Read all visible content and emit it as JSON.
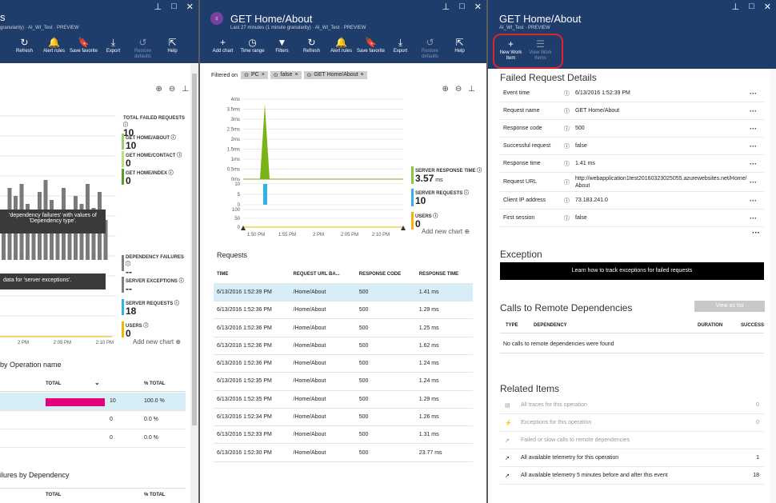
{
  "blade1": {
    "title": "s",
    "subtitle": "granularity) · AI_WI_Test · PREVIEW",
    "toolbar": [
      {
        "label": "Refresh",
        "icon": "↻"
      },
      {
        "label": "Alert rules",
        "icon": "🔔"
      },
      {
        "label": "Save favorite",
        "icon": "🔖"
      },
      {
        "label": "Export",
        "icon": "⤓"
      },
      {
        "label": "Restore defaults",
        "icon": "↺"
      },
      {
        "label": "Help",
        "icon": "⇱"
      }
    ],
    "metrics": [
      {
        "label": "TOTAL FAILED REQUESTS",
        "value": "10",
        "color": ""
      },
      {
        "label": "GET HOME/ABOUT",
        "value": "10",
        "color": "#9bd16a"
      },
      {
        "label": "GET HOME/CONTACT",
        "value": "0",
        "color": "#b8e07d"
      },
      {
        "label": "GET HOME/INDEX",
        "value": "0",
        "color": "#5b9b2a"
      },
      {
        "label": "DEPENDENCY FAILURES",
        "value": "--",
        "color": "#7f7f7f"
      },
      {
        "label": "SERVER EXCEPTIONS",
        "value": "--",
        "color": "#7f7f7f"
      },
      {
        "label": "SERVER REQUESTS",
        "value": "18",
        "color": "#2fb3e8"
      },
      {
        "label": "USERS",
        "value": "0",
        "color": "#f2b800"
      }
    ],
    "tooltip1": "'dependency failures' with values of 'Dependency type'.",
    "tooltip2": "data for 'server exceptions'.",
    "xticks": [
      "2 PM",
      "2:05 PM",
      "2:10 PM"
    ],
    "add_chart": "Add new chart",
    "grid1_title": "by Operation name",
    "grid1_headers": [
      "TOTAL",
      "% TOTAL"
    ],
    "grid1_rows": [
      {
        "total": "10",
        "pct": "100.0 %",
        "bar": 1.0
      },
      {
        "total": "0",
        "pct": "0.0 %",
        "bar": 0
      },
      {
        "total": "0",
        "pct": "0.0 %",
        "bar": 0
      }
    ],
    "grid2_title": "ilures by Dependency",
    "grid2_headers": [
      "TOTAL",
      "% TOTAL"
    ]
  },
  "blade2": {
    "title": "GET Home/About",
    "subtitle": "Last 27 minutes (1 minute granularity) · AI_WI_Test · PREVIEW",
    "toolbar": [
      {
        "label": "Add chart",
        "icon": "+"
      },
      {
        "label": "Time range",
        "icon": "◷"
      },
      {
        "label": "Filters",
        "icon": "▼"
      },
      {
        "label": "Refresh",
        "icon": "↻"
      },
      {
        "label": "Alert rules",
        "icon": "🔔"
      },
      {
        "label": "Save favorite",
        "icon": "🔖"
      },
      {
        "label": "Export",
        "icon": "⤓"
      },
      {
        "label": "Restore defaults",
        "icon": "↺"
      },
      {
        "label": "Help",
        "icon": "⇱"
      }
    ],
    "filtered_on": "Filtered on",
    "filters": [
      "PC",
      "false",
      "GET Home/About"
    ],
    "yticks": [
      "4ms",
      "3.5ms",
      "3ms",
      "2.5ms",
      "2ms",
      "1.5ms",
      "1ms",
      "0.5ms",
      "0ms"
    ],
    "y2ticks": [
      "10",
      "5",
      "0"
    ],
    "y3ticks": [
      "100",
      "50",
      "0"
    ],
    "xticks": [
      "1:50 PM",
      "1:55 PM",
      "2 PM",
      "2:05 PM",
      "2:10 PM"
    ],
    "metrics": [
      {
        "label": "SERVER RESPONSE TIME",
        "value": "3.57",
        "unit": "ms",
        "color": "#8cc63f"
      },
      {
        "label": "SERVER REQUESTS",
        "value": "10",
        "unit": "",
        "color": "#2fb3e8"
      },
      {
        "label": "USERS",
        "value": "0",
        "unit": "",
        "color": "#f2b800"
      }
    ],
    "add_chart": "Add new chart",
    "requests_title": "Requests",
    "headers": [
      "TIME",
      "REQUEST URL BA...",
      "RESPONSE CODE",
      "RESPONSE TIME"
    ],
    "rows": [
      [
        "6/13/2016 1:52:39 PM",
        "/Home/About",
        "500",
        "1.41 ms"
      ],
      [
        "6/13/2016 1:52:36 PM",
        "/Home/About",
        "500",
        "1.29 ms"
      ],
      [
        "6/13/2016 1:52:36 PM",
        "/Home/About",
        "500",
        "1.25 ms"
      ],
      [
        "6/13/2016 1:52:36 PM",
        "/Home/About",
        "500",
        "1.62 ms"
      ],
      [
        "6/13/2016 1:52:36 PM",
        "/Home/About",
        "500",
        "1.24 ms"
      ],
      [
        "6/13/2016 1:52:35 PM",
        "/Home/About",
        "500",
        "1.24 ms"
      ],
      [
        "6/13/2016 1:52:35 PM",
        "/Home/About",
        "500",
        "1.29 ms"
      ],
      [
        "6/13/2016 1:52:34 PM",
        "/Home/About",
        "500",
        "1.26 ms"
      ],
      [
        "6/13/2016 1:52:33 PM",
        "/Home/About",
        "500",
        "1.31 ms"
      ],
      [
        "6/13/2016 1:52:30 PM",
        "/Home/About",
        "500",
        "23.77 ms"
      ]
    ]
  },
  "blade3": {
    "title": "GET Home/About",
    "subtitle": "AI_WI_Test · PREVIEW",
    "toolbar": [
      {
        "label": "New Work Item",
        "icon": "+"
      },
      {
        "label": "View Work Items",
        "icon": "☰"
      }
    ],
    "details_title": "Failed Request Details",
    "details": [
      {
        "label": "Event time",
        "value": "6/13/2016 1:52:39 PM"
      },
      {
        "label": "Request name",
        "value": "GET Home/About"
      },
      {
        "label": "Response code",
        "value": "500"
      },
      {
        "label": "Successful request",
        "value": "false"
      },
      {
        "label": "Response time",
        "value": "1.41 ms"
      },
      {
        "label": "Request URL",
        "value": "http://webapplication1test20160323025055.azurewebsites.net/Home/About"
      },
      {
        "label": "Client IP address",
        "value": "73.183.241.0"
      },
      {
        "label": "First session",
        "value": "false"
      }
    ],
    "exception_title": "Exception",
    "exception_button": "Learn how to track exceptions for failed requests",
    "deps_title": "Calls to Remote Dependencies",
    "view_as_list": "View as list",
    "deps_headers": [
      "TYPE",
      "DEPENDENCY",
      "DURATION",
      "SUCCESS"
    ],
    "deps_empty": "No calls to remote dependencies were found",
    "related_title": "Related Items",
    "related": [
      {
        "label": "All traces for this operation",
        "count": "0",
        "enabled": false,
        "icon": "▤"
      },
      {
        "label": "Exceptions for this operation",
        "count": "0",
        "enabled": false,
        "icon": "⚡"
      },
      {
        "label": "Failed or slow calls to remote dependencies",
        "count": "",
        "enabled": false,
        "icon": "↗"
      },
      {
        "label": "All available telemetry for this operation",
        "count": "1",
        "enabled": true,
        "icon": "↗"
      },
      {
        "label": "All available telemetry 5 minutes before and after this event",
        "count": "18",
        "enabled": true,
        "icon": "↗"
      }
    ]
  },
  "window_controls": {
    "pin": "📌",
    "maximize": "□",
    "close": "✕"
  }
}
